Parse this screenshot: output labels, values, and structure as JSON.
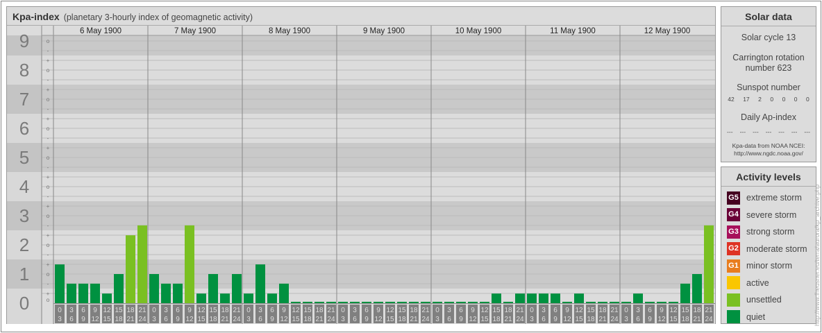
{
  "title": {
    "main": "Kpa-index",
    "sub": "(planetary 3-hourly index of geomagnetic activity)"
  },
  "colors": {
    "quiet": "#009140",
    "unsettled": "#7ac022",
    "active": "#fac600",
    "g1": "#e87d1e",
    "g2": "#de3224",
    "g3": "#a70f5a",
    "g4": "#6a0037",
    "g5": "#450020"
  },
  "chart_data": {
    "type": "bar",
    "title": "Kpa-index",
    "ylim": [
      0,
      9
    ],
    "y_ticks": [
      "0",
      "1",
      "2",
      "3",
      "4",
      "5",
      "6",
      "7",
      "8",
      "9"
    ],
    "sub_ticks": [
      "o",
      "+",
      "-",
      "o",
      "+",
      "-",
      "o",
      "+",
      "-",
      "o",
      "+",
      "-",
      "o",
      "+",
      "-",
      "o",
      "+",
      "-",
      "o",
      "+",
      "-",
      "o",
      "+",
      "-",
      "o",
      "+",
      "-",
      "o"
    ],
    "days": [
      "6 May 1900",
      "7 May 1900",
      "8 May 1900",
      "9 May 1900",
      "10 May 1900",
      "11 May 1900",
      "12 May 1900"
    ],
    "intervals": [
      [
        "0",
        "3"
      ],
      [
        "3",
        "6"
      ],
      [
        "6",
        "9"
      ],
      [
        "9",
        "12"
      ],
      [
        "12",
        "15"
      ],
      [
        "15",
        "18"
      ],
      [
        "18",
        "21"
      ],
      [
        "21",
        "24"
      ]
    ],
    "values": [
      [
        1.33,
        0.67,
        0.67,
        0.67,
        0.33,
        1,
        2.33,
        2.67
      ],
      [
        1,
        0.67,
        0.67,
        2.67,
        0.33,
        1,
        0.33,
        1
      ],
      [
        0.33,
        1.33,
        0.33,
        0.67,
        0,
        0,
        0,
        0
      ],
      [
        0,
        0,
        0,
        0,
        0,
        0,
        0,
        0
      ],
      [
        0,
        0,
        0,
        0,
        0,
        0.33,
        0,
        0.33
      ],
      [
        0.33,
        0.33,
        0.33,
        0,
        0.33,
        0,
        0,
        0
      ],
      [
        0,
        0.33,
        0,
        0,
        0,
        0.67,
        1,
        2.67
      ]
    ]
  },
  "solar": {
    "title": "Solar data",
    "cycle": "Solar cycle 13",
    "carrington1": "Carrington rotation",
    "carrington2": "number 623",
    "sunspot_label": "Sunspot number",
    "sunspots": [
      "42",
      "17",
      "2",
      "0",
      "0",
      "0",
      "0"
    ],
    "ap_label": "Daily Ap-index",
    "ap": [
      "---",
      "---",
      "---",
      "---",
      "---",
      "---",
      "---"
    ],
    "source1": "Kpa-data from NOAA NCEI:",
    "source2": "http://www.ngdc.noaa.gov/"
  },
  "levels": {
    "title": "Activity levels",
    "items": [
      {
        "code": "G5",
        "label": "extreme storm",
        "color": "#450020"
      },
      {
        "code": "G4",
        "label": "severe storm",
        "color": "#6a0037"
      },
      {
        "code": "G3",
        "label": "strong storm",
        "color": "#a70f5a"
      },
      {
        "code": "G2",
        "label": "moderate storm",
        "color": "#de3224"
      },
      {
        "code": "G1",
        "label": "minor storm",
        "color": "#e87d1e"
      },
      {
        "code": "",
        "label": "active",
        "color": "#fac600"
      },
      {
        "code": "",
        "label": "unsettled",
        "color": "#7ac022"
      },
      {
        "code": "",
        "label": "quiet",
        "color": "#009140"
      }
    ]
  },
  "watermark": "http://www.fheusner.eu/terra/aurora/kp_archive.php"
}
